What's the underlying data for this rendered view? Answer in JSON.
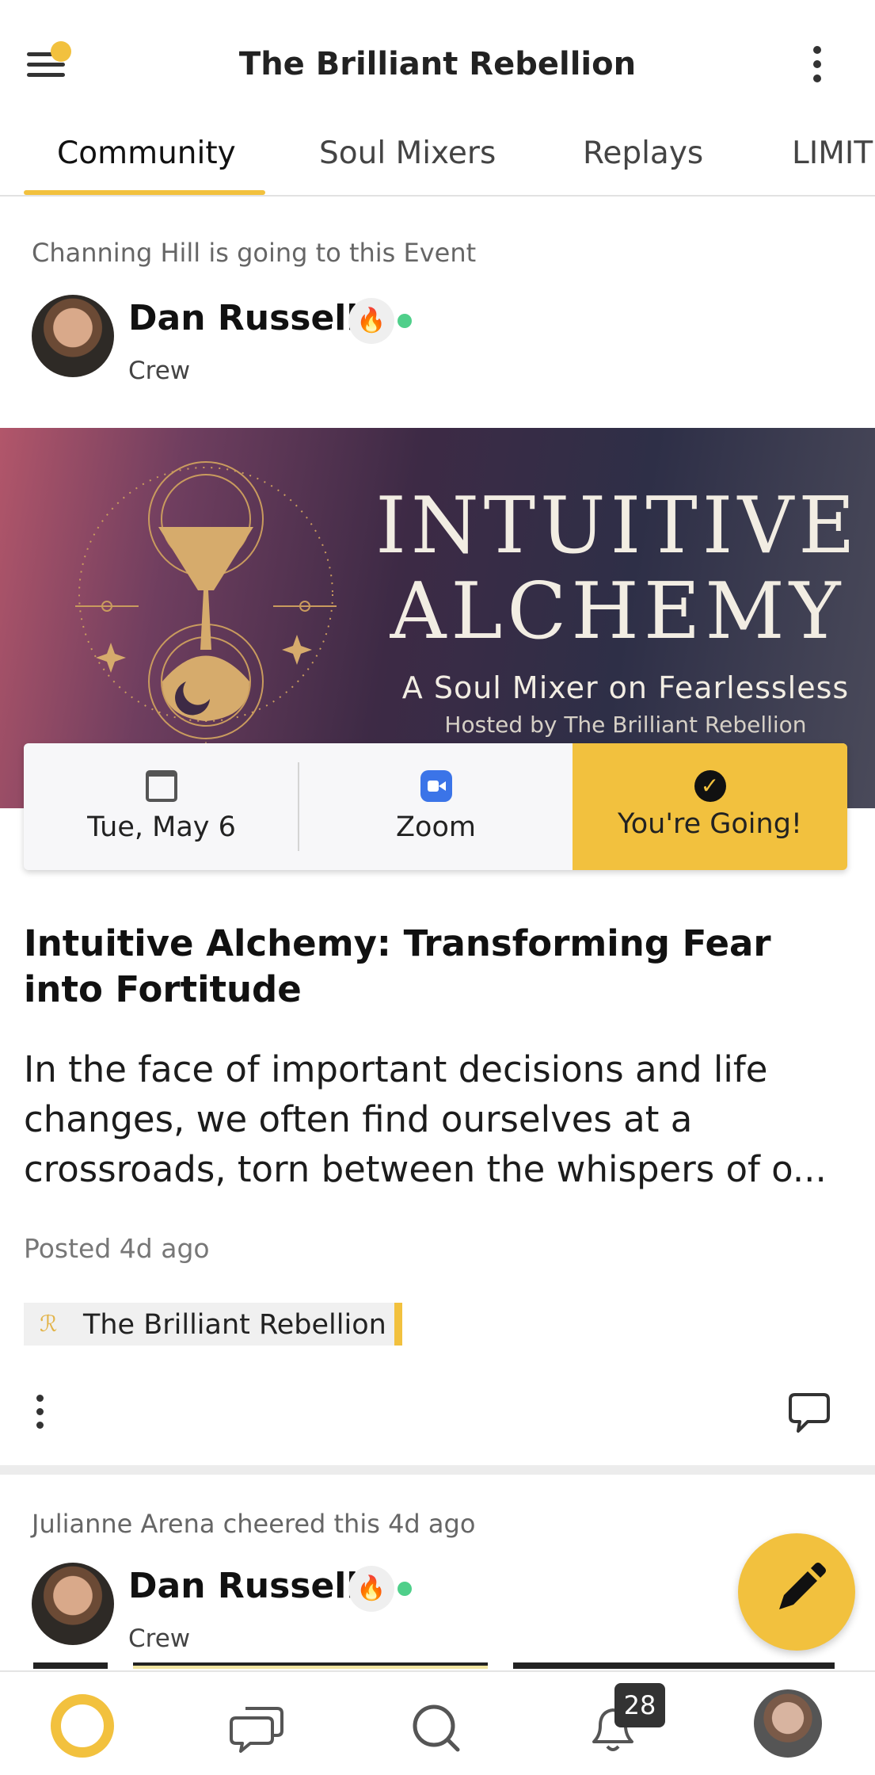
{
  "header": {
    "title": "The Brilliant Rebellion",
    "menu_icon": "menu-icon",
    "more_icon": "more-vertical-icon"
  },
  "tabs": [
    {
      "label": "Community",
      "active": true
    },
    {
      "label": "Soul Mixers",
      "active": false
    },
    {
      "label": "Replays",
      "active": false
    },
    {
      "label": "LIMIT",
      "active": false
    }
  ],
  "post1": {
    "activity": "Channing Hill is going to this Event",
    "author": {
      "name": "Dan Russell",
      "role": "Crew",
      "badge": "🔥",
      "online": true
    },
    "banner": {
      "title_line1": "INTUITIVE",
      "title_line2": "ALCHEMY",
      "subtitle": "A Soul Mixer on Fearlessless",
      "host": "Hosted by The Brilliant Rebellion"
    },
    "event": {
      "date": "Tue, May 6",
      "location": "Zoom",
      "rsvp": "You're Going!",
      "check_mark": "✓"
    },
    "title": "Intuitive Alchemy: Transforming Fear into Fortitude",
    "body": "In the face of important decisions and life changes, we often find ourselves at a crossroads, torn between the whispers of o...",
    "posted": "Posted 4d ago",
    "space": {
      "name": "The Brilliant Rebellion",
      "icon_glyph": "ℛ"
    }
  },
  "post2": {
    "activity": "Julianne Arena cheered this 4d ago",
    "author": {
      "name": "Dan Russell",
      "role": "Crew",
      "badge": "🔥",
      "online": true
    }
  },
  "bottom_nav": {
    "notifications_count": "28",
    "items": [
      "home",
      "chats",
      "search",
      "notifications",
      "profile"
    ]
  },
  "colors": {
    "accent": "#f2c13e",
    "online": "#4fcf8a",
    "zoom": "#3b74e8"
  }
}
